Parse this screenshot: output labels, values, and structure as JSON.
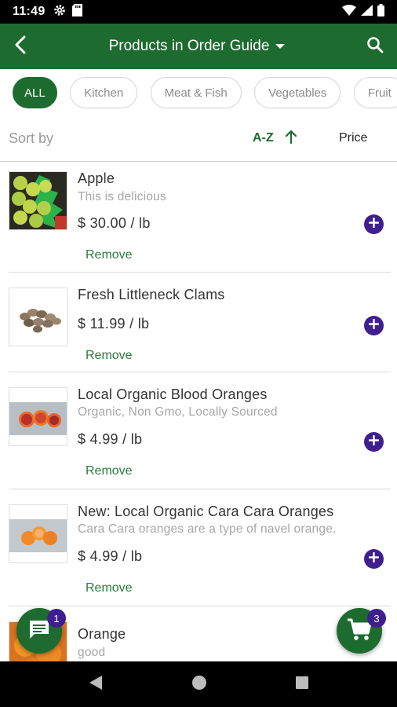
{
  "status_bar": {
    "time": "11:49",
    "icons": [
      "gear-icon",
      "sd-card-icon",
      "wifi-icon",
      "signal-icon",
      "battery-icon"
    ]
  },
  "header": {
    "title": "Products in Order Guide",
    "icons": [
      "back-arrow-icon",
      "dropdown-caret-icon",
      "search-icon"
    ]
  },
  "chips": [
    {
      "label": "ALL",
      "active": true
    },
    {
      "label": "Kitchen",
      "active": false
    },
    {
      "label": "Meat & Fish",
      "active": false
    },
    {
      "label": "Vegetables",
      "active": false
    },
    {
      "label": "Fruit",
      "active": false
    }
  ],
  "sort": {
    "label": "Sort by",
    "az_label": "A-Z",
    "price_label": "Price"
  },
  "products": [
    {
      "name": "Apple",
      "description": "This is delicious",
      "price": "$ 30.00 / lb",
      "remove_label": "Remove",
      "image": "green-apples"
    },
    {
      "name": "Fresh Littleneck Clams",
      "description": "",
      "price": "$ 11.99 / lb",
      "remove_label": "Remove",
      "image": "clams"
    },
    {
      "name": "Local Organic Blood Oranges",
      "description": "Organic, Non Gmo, Locally Sourced",
      "price": "$ 4.99 / lb",
      "remove_label": "Remove",
      "image": "blood-oranges"
    },
    {
      "name": "New: Local Organic Cara Cara Oranges",
      "description": "Cara Cara oranges are a type of navel orange.",
      "price": "$ 4.99 / lb",
      "remove_label": "Remove",
      "image": "cara-cara-oranges"
    },
    {
      "name": "Orange",
      "description": "good",
      "price": "",
      "remove_label": "",
      "image": "oranges"
    }
  ],
  "chat_fab": {
    "badge": "1"
  },
  "cart_fab": {
    "badge": "3"
  },
  "colors": {
    "brand_green": "#1e6b30",
    "accent_purple": "#3f1f8f"
  }
}
